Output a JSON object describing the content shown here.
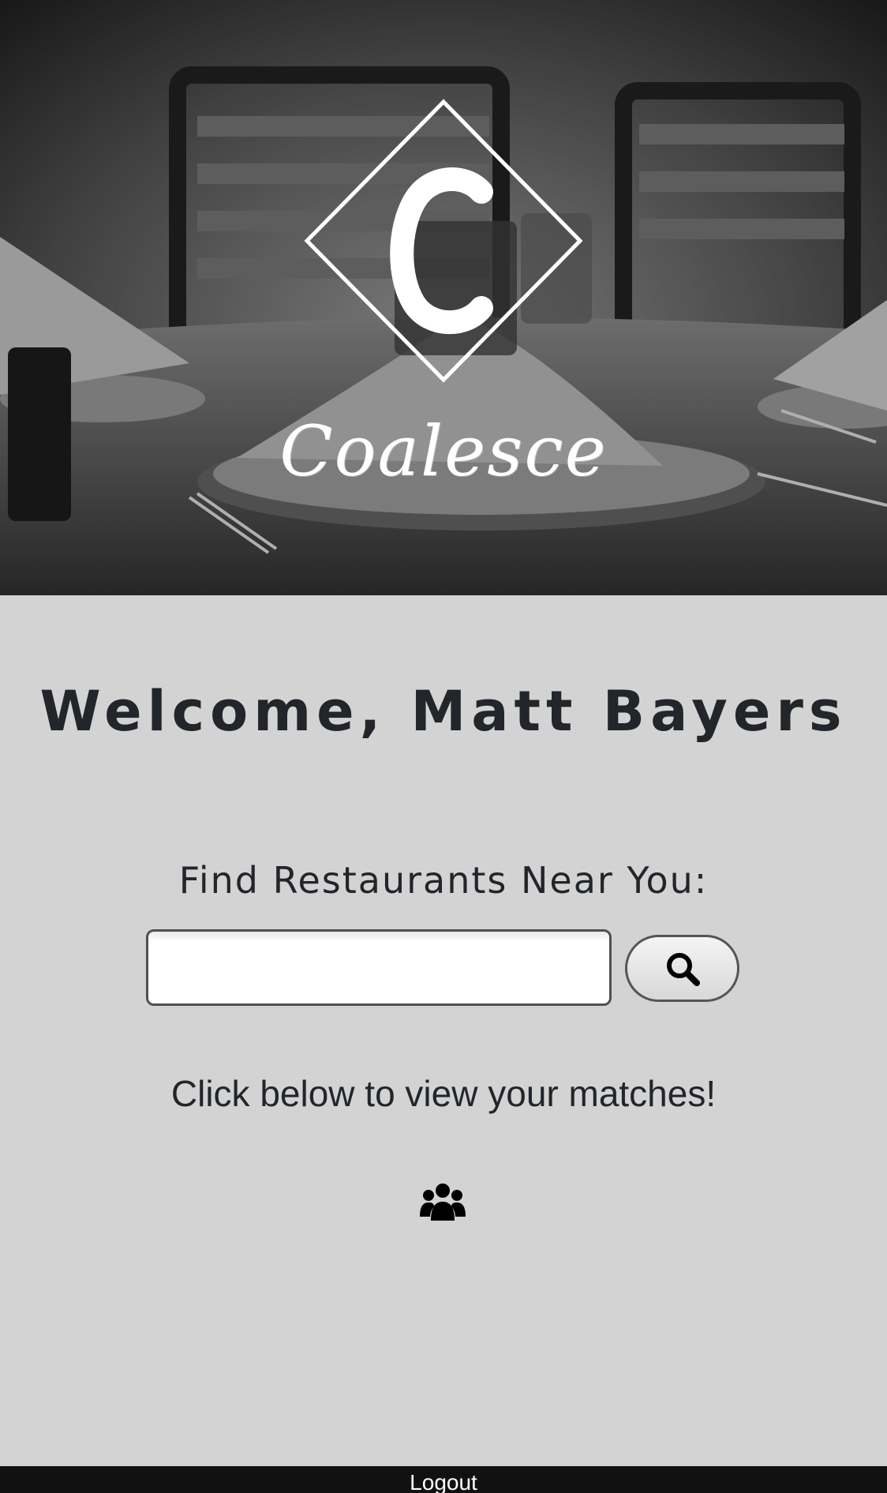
{
  "brand": {
    "logo_letter": "C",
    "name": "Coalesce"
  },
  "welcome": {
    "text": "Welcome, Matt Bayers"
  },
  "search": {
    "label": "Find Restaurants Near You:",
    "input_value": "",
    "button_icon": "search-icon"
  },
  "matches": {
    "prompt": "Click below to view your matches!",
    "icon": "users-icon"
  },
  "footer": {
    "logout_label": "Logout"
  },
  "colors": {
    "page_background": "#d3d3d3",
    "text": "#22252a",
    "footer_background": "#111111"
  }
}
